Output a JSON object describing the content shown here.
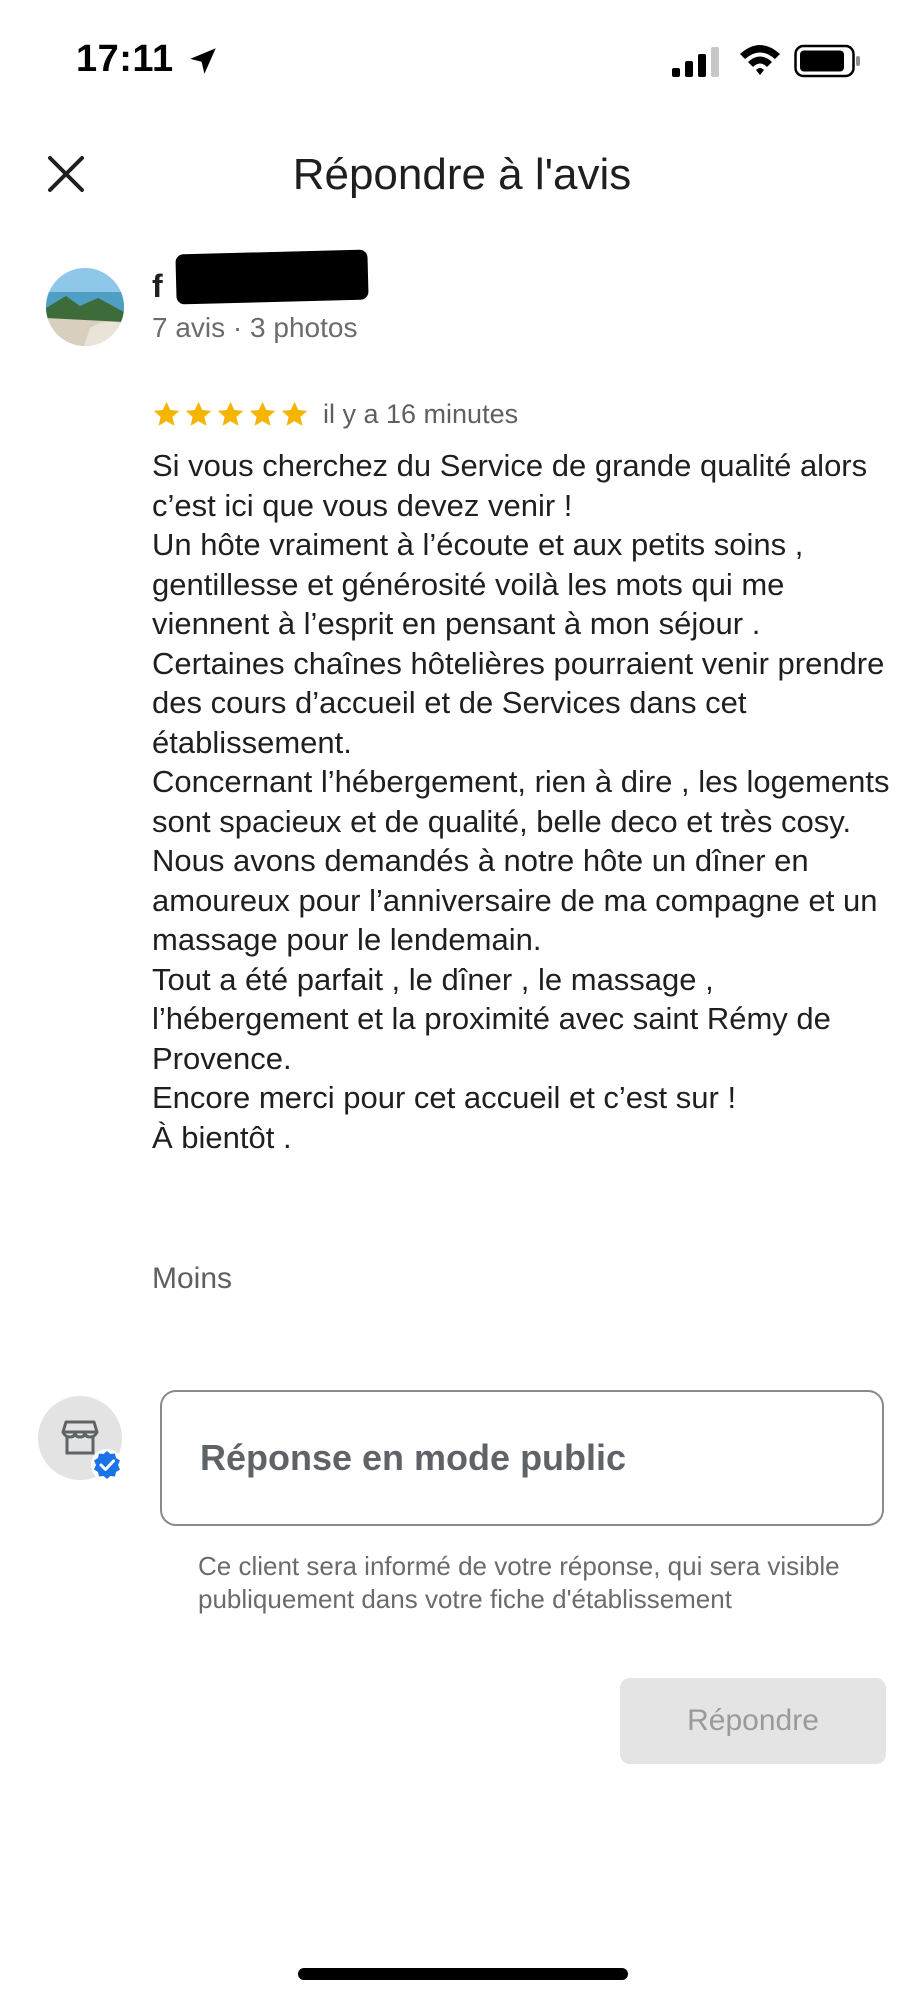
{
  "status_bar": {
    "time": "17:11",
    "icons": [
      "location-arrow-icon",
      "cellular-signal-icon",
      "wifi-icon",
      "battery-icon"
    ]
  },
  "header": {
    "title": "Répondre à l'avis",
    "close_icon": "close-icon"
  },
  "review": {
    "reviewer_name_visible": "f",
    "reviewer_meta": "7 avis · 3 photos",
    "rating": 5,
    "rating_max": 5,
    "star_color": "#f5b400",
    "time_ago": "il y a 16 minutes",
    "text": "Si vous cherchez du Service de grande qualité alors c’est ici que vous devez venir !\nUn hôte vraiment à l’écoute et aux petits soins , gentillesse et générosité voilà les mots qui me viennent à l’esprit en pensant à mon séjour .\nCertaines chaînes hôtelières pourraient venir prendre des cours d’accueil et de Services dans cet établissement.\nConcernant l’hébergement, rien à dire , les logements sont spacieux et de qualité, belle deco et très cosy.\nNous avons demandés à notre hôte un dîner en amoureux pour l’anniversaire de ma compagne et un massage pour le lendemain.\nTout a été parfait , le dîner , le massage , l’hébergement et la proximité avec saint Rémy de Provence.\nEncore merci pour cet accueil et c’est sur !\nÀ bientôt .",
    "less_label": "Moins"
  },
  "reply": {
    "business_icon": "store-icon",
    "verified_icon": "verified-badge-icon",
    "verified_color": "#1a73e8",
    "placeholder": "Réponse en mode public",
    "value": "",
    "helper_text": "Ce client sera informé de votre réponse, qui sera visible publiquement dans votre fiche d'établissement",
    "submit_label": "Répondre",
    "submit_enabled": false
  }
}
